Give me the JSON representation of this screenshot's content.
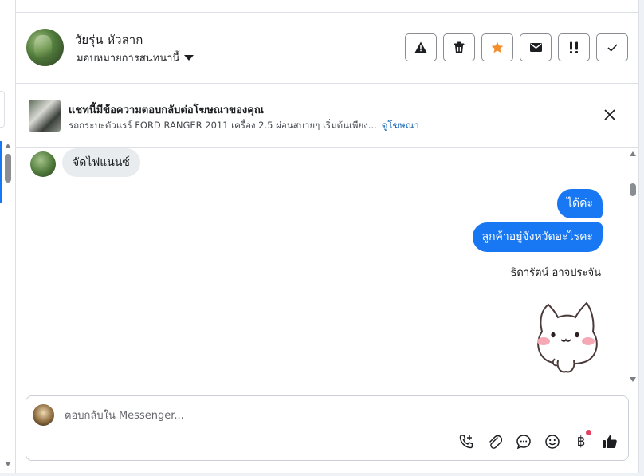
{
  "header": {
    "user_name": "วัยรุ่น หัวลาก",
    "assign_label": "มอบหมายการสนทนานี้"
  },
  "actions": [
    {
      "name": "report-spam-icon"
    },
    {
      "name": "trash-icon"
    },
    {
      "name": "star-icon",
      "color": "#f38e2e"
    },
    {
      "name": "envelope-icon"
    },
    {
      "name": "follow-up-icon"
    },
    {
      "name": "check-icon"
    }
  ],
  "ad": {
    "title": "แชทนี้มีข้อความตอบกลับต่อโฆษณาของคุณ",
    "description": "รถกระบะตัวแรร์ FORD RANGER 2011 เครื่อง 2.5 ผ่อนสบายๆ เริ่มต้นเพียง...",
    "link": "ดูโฆษณา"
  },
  "messages": {
    "incoming": "จัดไฟแนนซ์",
    "outgoing": [
      "ได้ค่ะ",
      "ลูกค้าอยู่จังหวัดอะไรคะ"
    ],
    "sender": "ธิดารัตน์ อาจประจัน"
  },
  "composer": {
    "placeholder": "ตอบกลับใน Messenger...",
    "currency_glyph": "฿"
  },
  "colors": {
    "accent": "#1877f2",
    "star": "#f38e2e",
    "notify_dot": "#e4405f"
  }
}
